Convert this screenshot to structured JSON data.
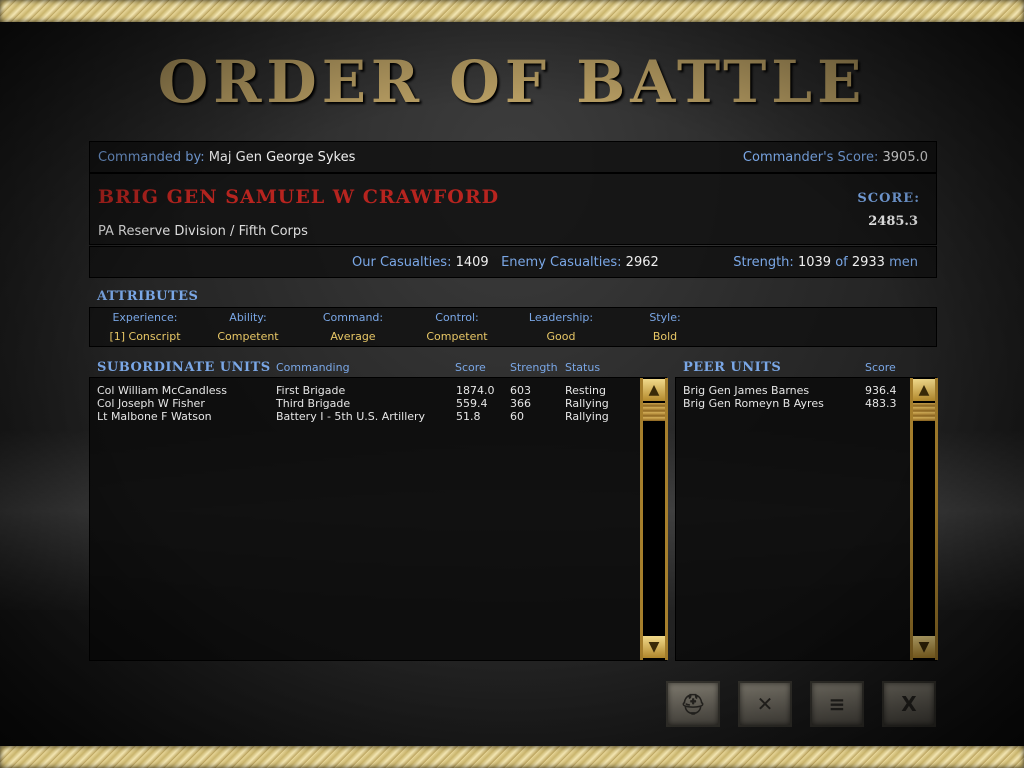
{
  "title": "ORDER OF BATTLE",
  "header": {
    "commanded_by_label": "Commanded by:",
    "commanded_by": "Maj Gen George Sykes",
    "commander_score_label": "Commander's Score:",
    "commander_score": "3905.0"
  },
  "commander": {
    "name": "BRIG GEN SAMUEL W CRAWFORD",
    "unit": "PA Reserve Division / Fifth Corps",
    "score_label": "SCORE:",
    "score": "2485.3"
  },
  "stats": {
    "our_casualties_label": "Our Casualties:",
    "our_casualties": "1409",
    "enemy_casualties_label": "Enemy Casualties:",
    "enemy_casualties": "2962",
    "strength_label": "Strength:",
    "strength": "1039",
    "of_label": "of",
    "max_strength": "2933",
    "men_label": "men"
  },
  "attributes": {
    "title": "ATTRIBUTES",
    "items": [
      {
        "label": "Experience:",
        "value": "[1] Conscript"
      },
      {
        "label": "Ability:",
        "value": "Competent"
      },
      {
        "label": "Command:",
        "value": "Average"
      },
      {
        "label": "Control:",
        "value": "Competent"
      },
      {
        "label": "Leadership:",
        "value": "Good"
      },
      {
        "label": "Style:",
        "value": "Bold"
      }
    ]
  },
  "subordinates": {
    "title": "SUBORDINATE UNITS",
    "columns": {
      "commanding": "Commanding",
      "score": "Score",
      "strength": "Strength",
      "status": "Status"
    },
    "rows": [
      {
        "name": "Col William McCandless",
        "commanding": "First Brigade",
        "score": "1874.0",
        "strength": "603",
        "status": "Resting"
      },
      {
        "name": "Col Joseph W Fisher",
        "commanding": "Third Brigade",
        "score": "559.4",
        "strength": "366",
        "status": "Rallying"
      },
      {
        "name": "Lt Malbone F Watson",
        "commanding": "Battery I - 5th U.S. Artillery",
        "score": "51.8",
        "strength": "60",
        "status": "Rallying"
      }
    ]
  },
  "peers": {
    "title": "PEER UNITS",
    "score_header": "Score",
    "rows": [
      {
        "name": "Brig Gen James Barnes",
        "score": "936.4"
      },
      {
        "name": "Brig Gen Romeyn B Ayres",
        "score": "483.3"
      }
    ]
  },
  "toolbar": {
    "icons": [
      "hat-icon",
      "flag-icon",
      "us-flag-icon",
      "close-icon"
    ]
  },
  "colors": {
    "title_gold": "#b89e63",
    "label_blue": "#7aa7e6",
    "value_yellow": "#e8c766",
    "commander_red": "#b7241f",
    "scroll_gold": "#a67f2c"
  }
}
